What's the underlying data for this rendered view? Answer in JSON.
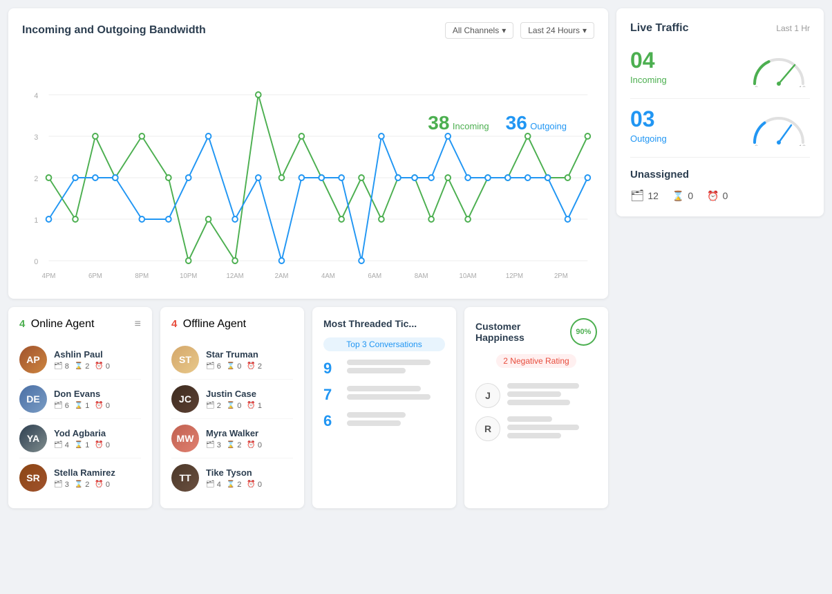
{
  "bandwidth": {
    "title": "Incoming and Outgoing Bandwidth",
    "filter_channels": "All Channels",
    "filter_period": "Last 24 Hours",
    "incoming_count": "38",
    "outgoing_count": "36",
    "incoming_label": "Incoming",
    "outgoing_label": "Outgoing",
    "y_labels": [
      "0",
      "1",
      "2",
      "3",
      "4"
    ],
    "x_labels": [
      "4PM",
      "6PM",
      "8PM",
      "10PM",
      "12AM",
      "2AM",
      "4AM",
      "6AM",
      "8AM",
      "10AM",
      "12PM",
      "2PM"
    ]
  },
  "live_traffic": {
    "title": "Live Traffic",
    "period": "Last 1 Hr",
    "incoming_num": "04",
    "incoming_label": "Incoming",
    "outgoing_num": "03",
    "outgoing_label": "Outgoing",
    "unassigned_title": "Unassigned",
    "unassigned_count": "12",
    "unassigned_urgent": "0",
    "unassigned_overdue": "0"
  },
  "online_agents": {
    "title": "Online Agent",
    "count": "4",
    "agents": [
      {
        "name": "Ashlin Paul",
        "tickets": "8",
        "urgent": "2",
        "overdue": "0",
        "avatar_class": "av-ashlin",
        "initials": "AP"
      },
      {
        "name": "Don Evans",
        "tickets": "6",
        "urgent": "1",
        "overdue": "0",
        "avatar_class": "av-don",
        "initials": "DE"
      },
      {
        "name": "Yod Agbaria",
        "tickets": "4",
        "urgent": "1",
        "overdue": "0",
        "avatar_class": "av-yod",
        "initials": "YA"
      },
      {
        "name": "Stella Ramirez",
        "tickets": "3",
        "urgent": "2",
        "overdue": "0",
        "avatar_class": "av-stella",
        "initials": "SR"
      }
    ]
  },
  "offline_agents": {
    "title": "Offline Agent",
    "count": "4",
    "agents": [
      {
        "name": "Star Truman",
        "tickets": "6",
        "urgent": "0",
        "overdue": "2",
        "avatar_class": "av-star",
        "initials": "ST"
      },
      {
        "name": "Justin Case",
        "tickets": "2",
        "urgent": "0",
        "overdue": "1",
        "avatar_class": "av-justin",
        "initials": "JC"
      },
      {
        "name": "Myra Walker",
        "tickets": "3",
        "urgent": "2",
        "overdue": "0",
        "avatar_class": "av-myra",
        "initials": "MW"
      },
      {
        "name": "Tike Tyson",
        "tickets": "4",
        "urgent": "2",
        "overdue": "0",
        "avatar_class": "av-tike",
        "initials": "TT"
      }
    ]
  },
  "most_threaded": {
    "title": "Most Threaded Tic...",
    "badge": "Top 3 Conversations",
    "items": [
      {
        "number": "9"
      },
      {
        "number": "7"
      },
      {
        "number": "6"
      }
    ]
  },
  "customer_happiness": {
    "title": "Customer Happiness",
    "percentage": "90%",
    "negative_label": "2  Negative Rating",
    "persons": [
      {
        "initial": "J"
      },
      {
        "initial": "R"
      }
    ]
  }
}
